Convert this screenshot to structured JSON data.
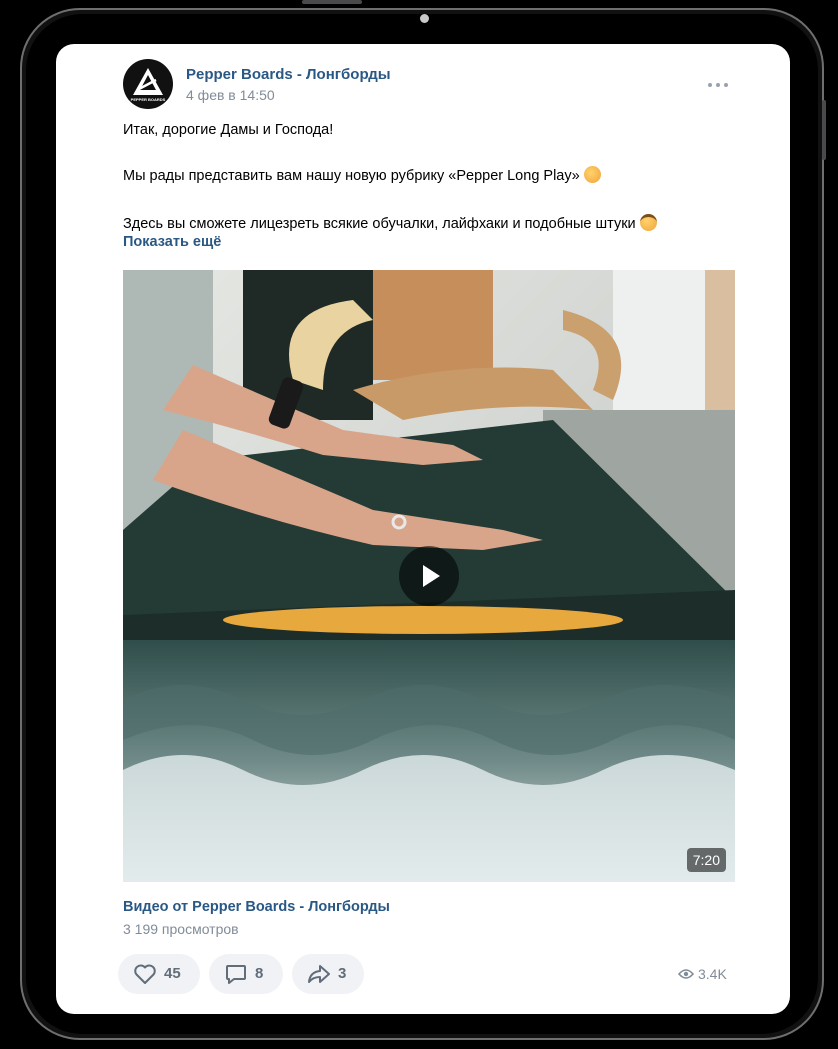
{
  "post": {
    "author": "Pepper Boards - Лонгборды",
    "date": "4 фев в 14:50",
    "logo_text": "PEPPER BOARDS",
    "text_lines": [
      "Итак, дорогие Дамы и Господа!",
      "Мы рады представить вам нашу новую рубрику «Pepper Long Play»",
      "Здесь вы сможете лицезреть всякие обучалки, лайфхаки и подобные штуки"
    ],
    "show_more": "Показать ещё"
  },
  "video": {
    "duration": "7:20",
    "title": "Видео от Pepper Boards - Лонгборды",
    "views": "3 199 просмотров"
  },
  "actions": {
    "likes": "45",
    "comments": "8",
    "shares": "3",
    "views": "3.4K"
  },
  "icons": {
    "more": "more-dots-icon",
    "like": "heart-icon",
    "comment": "comment-icon",
    "share": "share-icon",
    "views": "eye-icon",
    "play": "play-icon",
    "emoji_1": "partying-face-emoji",
    "emoji_2": "nerd-face-emoji"
  },
  "colors": {
    "link": "#2a5885",
    "secondary": "#818c99",
    "button_bg": "#f0f2f5"
  }
}
